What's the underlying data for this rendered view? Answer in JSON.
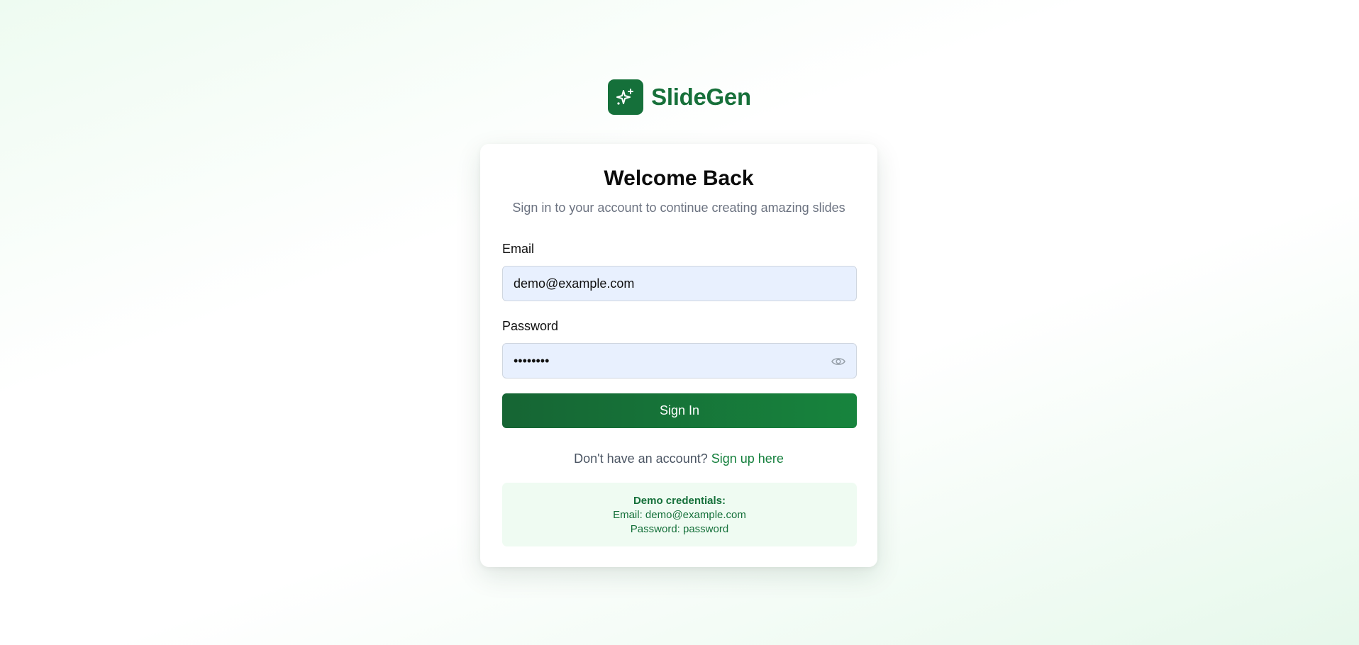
{
  "brand": {
    "name": "SlideGen",
    "logo_icon": "sparkles-icon",
    "color": "#17703a"
  },
  "login": {
    "title": "Welcome Back",
    "subtitle": "Sign in to your account to continue creating amazing slides",
    "email_label": "Email",
    "email_value": "demo@example.com",
    "password_label": "Password",
    "password_value": "password",
    "password_toggle_icon": "eye-icon",
    "submit_label": "Sign In",
    "signup_prompt": "Don't have an account?",
    "signup_link": "Sign up here"
  },
  "demo": {
    "title": "Demo credentials:",
    "email_line": "Email: demo@example.com",
    "password_line": "Password: password"
  },
  "colors": {
    "accent": "#166534",
    "input_bg": "#e8f0fe",
    "demo_bg": "#effbf2"
  }
}
